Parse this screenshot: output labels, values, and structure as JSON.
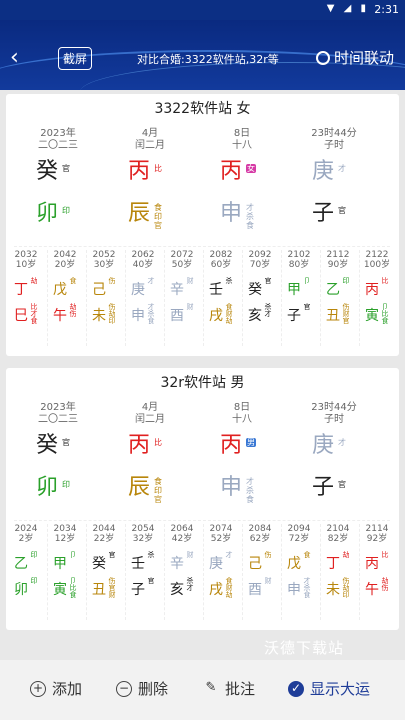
{
  "status": {
    "time": "2:31",
    "icons": "▼ ◢ ▮"
  },
  "header": {
    "back_icon": "back-arrow",
    "screenshot_label": "截屏",
    "compare_label": "对比合婚:3322软件站,32r等",
    "time_link_label": "时间联动"
  },
  "colors": {
    "fire": "#e02020",
    "earth": "#b8860b",
    "water": "#222222",
    "metal": "#9aa8c0",
    "wood": "#2aa02a",
    "header": "#0c2f84"
  },
  "charts": [
    {
      "title": "3322软件站 女",
      "pillars": [
        {
          "date": "2023年",
          "sub": "二〇二三",
          "stem": "癸",
          "stem_color": "water",
          "stem_tag": "官",
          "stem_tag_box": false,
          "branch": "卯",
          "branch_color": "wood",
          "branch_tags": [
            "印"
          ]
        },
        {
          "date": "4月",
          "sub": "闰二月",
          "stem": "丙",
          "stem_color": "fire",
          "stem_tag": "比",
          "stem_tag_box": false,
          "branch": "辰",
          "branch_color": "earth",
          "branch_tags": [
            "食",
            "印",
            "官"
          ]
        },
        {
          "date": "8日",
          "sub": "十八",
          "stem": "丙",
          "stem_color": "fire",
          "stem_tag": "女",
          "stem_tag_box": true,
          "branch": "申",
          "branch_color": "metal",
          "branch_tags": [
            "才",
            "杀",
            "食"
          ]
        },
        {
          "date": "23时44分",
          "sub": "子时",
          "stem": "庚",
          "stem_color": "metal",
          "stem_tag": "才",
          "stem_tag_box": false,
          "branch": "子",
          "branch_color": "water",
          "branch_tags": [
            "官"
          ]
        }
      ],
      "dayun": [
        {
          "year": "2032",
          "age": "10岁",
          "stem": "丁",
          "stem_color": "fire",
          "stem_tags": [
            "劫"
          ],
          "branch": "巳",
          "branch_color": "fire",
          "branch_tags": [
            "比",
            "才",
            "食"
          ]
        },
        {
          "year": "2042",
          "age": "20岁",
          "stem": "戊",
          "stem_color": "earth",
          "stem_tags": [
            "食"
          ],
          "branch": "午",
          "branch_color": "fire",
          "branch_tags": [
            "劫",
            "伤"
          ]
        },
        {
          "year": "2052",
          "age": "30岁",
          "stem": "己",
          "stem_color": "earth",
          "stem_tags": [
            "伤"
          ],
          "branch": "未",
          "branch_color": "earth",
          "branch_tags": [
            "伤",
            "劫",
            "印"
          ]
        },
        {
          "year": "2062",
          "age": "40岁",
          "stem": "庚",
          "stem_color": "metal",
          "stem_tags": [
            "才"
          ],
          "branch": "申",
          "branch_color": "metal",
          "branch_tags": [
            "才",
            "杀",
            "食"
          ]
        },
        {
          "year": "2072",
          "age": "50岁",
          "stem": "辛",
          "stem_color": "metal",
          "stem_tags": [
            "财"
          ],
          "branch": "酉",
          "branch_color": "metal",
          "branch_tags": [
            "财"
          ]
        },
        {
          "year": "2082",
          "age": "60岁",
          "stem": "壬",
          "stem_color": "water",
          "stem_tags": [
            "杀"
          ],
          "branch": "戌",
          "branch_color": "earth",
          "branch_tags": [
            "食",
            "财",
            "劫"
          ]
        },
        {
          "year": "2092",
          "age": "70岁",
          "stem": "癸",
          "stem_color": "water",
          "stem_tags": [
            "官"
          ],
          "branch": "亥",
          "branch_color": "water",
          "branch_tags": [
            "杀",
            "才"
          ]
        },
        {
          "year": "2102",
          "age": "80岁",
          "stem": "甲",
          "stem_color": "wood",
          "stem_tags": [
            "卩"
          ],
          "branch": "子",
          "branch_color": "water",
          "branch_tags": [
            "官"
          ]
        },
        {
          "year": "2112",
          "age": "90岁",
          "stem": "乙",
          "stem_color": "wood",
          "stem_tags": [
            "印"
          ],
          "branch": "丑",
          "branch_color": "earth",
          "branch_tags": [
            "伤",
            "财",
            "官"
          ]
        },
        {
          "year": "2122",
          "age": "100岁",
          "stem": "丙",
          "stem_color": "fire",
          "stem_tags": [
            "比"
          ],
          "branch": "寅",
          "branch_color": "wood",
          "branch_tags": [
            "卩",
            "比",
            "食"
          ]
        }
      ]
    },
    {
      "title": "32r软件站 男",
      "pillars": [
        {
          "date": "2023年",
          "sub": "二〇二三",
          "stem": "癸",
          "stem_color": "water",
          "stem_tag": "官",
          "stem_tag_box": false,
          "branch": "卯",
          "branch_color": "wood",
          "branch_tags": [
            "印"
          ]
        },
        {
          "date": "4月",
          "sub": "闰二月",
          "stem": "丙",
          "stem_color": "fire",
          "stem_tag": "比",
          "stem_tag_box": false,
          "branch": "辰",
          "branch_color": "earth",
          "branch_tags": [
            "食",
            "印",
            "官"
          ]
        },
        {
          "date": "8日",
          "sub": "十八",
          "stem": "丙",
          "stem_color": "fire",
          "stem_tag": "男",
          "stem_tag_box": true,
          "branch": "申",
          "branch_color": "metal",
          "branch_tags": [
            "才",
            "杀",
            "食"
          ]
        },
        {
          "date": "23时44分",
          "sub": "子时",
          "stem": "庚",
          "stem_color": "metal",
          "stem_tag": "才",
          "stem_tag_box": false,
          "branch": "子",
          "branch_color": "water",
          "branch_tags": [
            "官"
          ]
        }
      ],
      "dayun": [
        {
          "year": "2024",
          "age": "2岁",
          "stem": "乙",
          "stem_color": "wood",
          "stem_tags": [
            "印"
          ],
          "branch": "卯",
          "branch_color": "wood",
          "branch_tags": [
            "印"
          ]
        },
        {
          "year": "2034",
          "age": "12岁",
          "stem": "甲",
          "stem_color": "wood",
          "stem_tags": [
            "卩"
          ],
          "branch": "寅",
          "branch_color": "wood",
          "branch_tags": [
            "卩",
            "比",
            "食"
          ]
        },
        {
          "year": "2044",
          "age": "22岁",
          "stem": "癸",
          "stem_color": "water",
          "stem_tags": [
            "官"
          ],
          "branch": "丑",
          "branch_color": "earth",
          "branch_tags": [
            "伤",
            "官",
            "财"
          ]
        },
        {
          "year": "2054",
          "age": "32岁",
          "stem": "壬",
          "stem_color": "water",
          "stem_tags": [
            "杀"
          ],
          "branch": "子",
          "branch_color": "water",
          "branch_tags": [
            "官"
          ]
        },
        {
          "year": "2064",
          "age": "42岁",
          "stem": "辛",
          "stem_color": "metal",
          "stem_tags": [
            "财"
          ],
          "branch": "亥",
          "branch_color": "water",
          "branch_tags": [
            "杀",
            "才"
          ]
        },
        {
          "year": "2074",
          "age": "52岁",
          "stem": "庚",
          "stem_color": "metal",
          "stem_tags": [
            "才"
          ],
          "branch": "戌",
          "branch_color": "earth",
          "branch_tags": [
            "食",
            "财",
            "劫"
          ]
        },
        {
          "year": "2084",
          "age": "62岁",
          "stem": "己",
          "stem_color": "earth",
          "stem_tags": [
            "伤"
          ],
          "branch": "酉",
          "branch_color": "metal",
          "branch_tags": [
            "财"
          ]
        },
        {
          "year": "2094",
          "age": "72岁",
          "stem": "戊",
          "stem_color": "earth",
          "stem_tags": [
            "食"
          ],
          "branch": "申",
          "branch_color": "metal",
          "branch_tags": [
            "才",
            "杀",
            "食"
          ]
        },
        {
          "year": "2104",
          "age": "82岁",
          "stem": "丁",
          "stem_color": "fire",
          "stem_tags": [
            "劫"
          ],
          "branch": "未",
          "branch_color": "earth",
          "branch_tags": [
            "伤",
            "劫",
            "印"
          ]
        },
        {
          "year": "2114",
          "age": "92岁",
          "stem": "丙",
          "stem_color": "fire",
          "stem_tags": [
            "比"
          ],
          "branch": "午",
          "branch_color": "fire",
          "branch_tags": [
            "劫",
            "伤"
          ]
        }
      ]
    }
  ],
  "watermark": "沃德下载站",
  "bottom": {
    "add_label": "添加",
    "delete_label": "删除",
    "annotate_label": "批注",
    "show_dayun_label": "显示大运"
  }
}
